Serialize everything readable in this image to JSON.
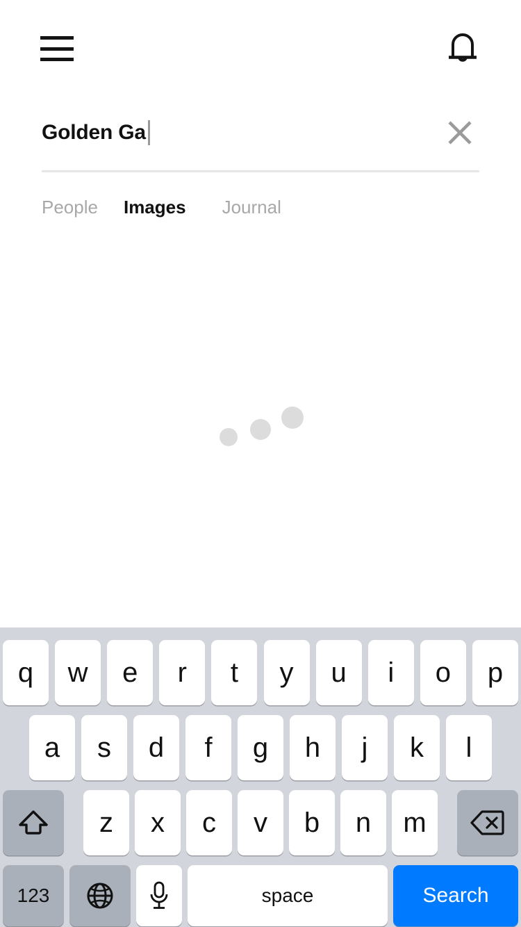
{
  "header": {
    "menu_icon": "hamburger-menu-icon",
    "notifications_icon": "bell-icon"
  },
  "search": {
    "value": "Golden Ga",
    "placeholder": "Search",
    "clear_icon": "close-x-icon",
    "caret_visible": true
  },
  "tabs": [
    {
      "label": "People",
      "active": false
    },
    {
      "label": "Images",
      "active": true
    },
    {
      "label": "Journal",
      "active": false
    }
  ],
  "results": {
    "state": "loading",
    "loader": "three-dot-loading-indicator",
    "dot_count": 3
  },
  "keyboard": {
    "layout": "qwerty-lowercase",
    "background_color": "#d2d5db",
    "key_color": "#ffffff",
    "modifier_key_color": "#aab0ba",
    "accent_color": "#007AFF",
    "rows": {
      "row1": [
        "q",
        "w",
        "e",
        "r",
        "t",
        "y",
        "u",
        "i",
        "o",
        "p"
      ],
      "row2": [
        "a",
        "s",
        "d",
        "f",
        "g",
        "h",
        "j",
        "k",
        "l"
      ],
      "row3": [
        "z",
        "x",
        "c",
        "v",
        "b",
        "n",
        "m"
      ]
    },
    "shift_key": {
      "name": "shift-key",
      "icon": "shift-arrow-up-icon"
    },
    "backspace_key": {
      "name": "backspace-key",
      "icon": "backspace-delete-icon"
    },
    "numbers_key": {
      "name": "numbers-key",
      "label": "123"
    },
    "globe_key": {
      "name": "globe-key",
      "icon": "globe-icon"
    },
    "dictation_key": {
      "name": "dictation-key",
      "icon": "microphone-icon"
    },
    "space_key": {
      "name": "space-key",
      "label": "space"
    },
    "return_key": {
      "name": "search-return-key",
      "label": "Search"
    }
  }
}
